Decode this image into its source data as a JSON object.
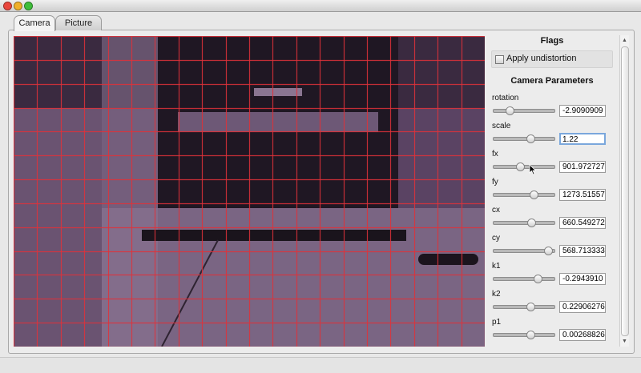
{
  "tabs": [
    {
      "label": "Camera",
      "active": true
    },
    {
      "label": "Picture",
      "active": false
    }
  ],
  "flags": {
    "title": "Flags",
    "apply_undistortion": {
      "label": "Apply undistortion",
      "checked": false
    }
  },
  "camera_parameters": {
    "title": "Camera Parameters",
    "params": [
      {
        "label": "rotation",
        "value": "-2.9090909",
        "slider_fraction": 0.26
      },
      {
        "label": "scale",
        "value": "1.22",
        "slider_fraction": 0.61,
        "focused": true
      },
      {
        "label": "fx",
        "value": "901.972727",
        "slider_fraction": 0.44
      },
      {
        "label": "fy",
        "value": "1273.51557",
        "slider_fraction": 0.66
      },
      {
        "label": "cx",
        "value": "660.549272",
        "slider_fraction": 0.62
      },
      {
        "label": "cy",
        "value": "568.713333",
        "slider_fraction": 0.9
      },
      {
        "label": "k1",
        "value": "-0.2943910",
        "slider_fraction": 0.73
      },
      {
        "label": "k2",
        "value": "0.22906276",
        "slider_fraction": 0.6
      },
      {
        "label": "p1",
        "value": "0.00268826",
        "slider_fraction": 0.61
      }
    ]
  },
  "colors": {
    "grid_line": "#e0323a",
    "image_tint": "#6a4d72",
    "focus_ring": "#7aa7dc"
  },
  "icons": {
    "scroll_up": "▲",
    "scroll_down": "▼"
  }
}
